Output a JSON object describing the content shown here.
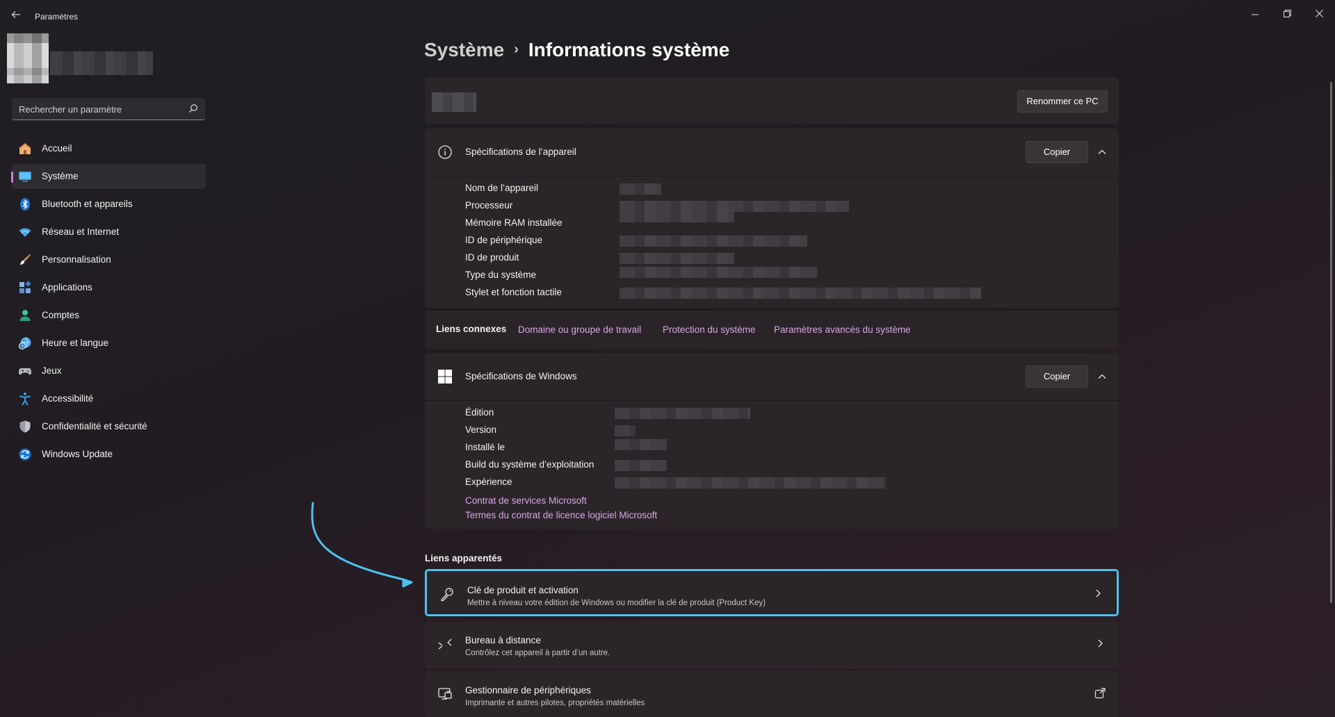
{
  "app": {
    "title": "Paramètres"
  },
  "search": {
    "placeholder": "Rechercher un paramètre"
  },
  "sidebar": {
    "items": [
      {
        "label": "Accueil",
        "icon": "home-icon"
      },
      {
        "label": "Système",
        "icon": "system-icon",
        "active": true
      },
      {
        "label": "Bluetooth et appareils",
        "icon": "bluetooth-icon"
      },
      {
        "label": "Réseau et Internet",
        "icon": "wifi-icon"
      },
      {
        "label": "Personnalisation",
        "icon": "brush-icon"
      },
      {
        "label": "Applications",
        "icon": "apps-icon"
      },
      {
        "label": "Comptes",
        "icon": "account-icon"
      },
      {
        "label": "Heure et langue",
        "icon": "globe-clock-icon"
      },
      {
        "label": "Jeux",
        "icon": "gamepad-icon"
      },
      {
        "label": "Accessibilité",
        "icon": "accessibility-icon"
      },
      {
        "label": "Confidentialité et sécurité",
        "icon": "shield-icon"
      },
      {
        "label": "Windows Update",
        "icon": "update-icon"
      }
    ]
  },
  "breadcrumb": {
    "parent": "Système",
    "separator": "›",
    "current": "Informations système"
  },
  "pc_card": {
    "rename_label": "Renommer ce PC"
  },
  "device_specs": {
    "title": "Spécifications de l’appareil",
    "copy_label": "Copier",
    "rows": [
      "Nom de l’appareil",
      "Processeur",
      "Mémoire RAM installée",
      "ID de périphérique",
      "ID de produit",
      "Type du système",
      "Stylet et fonction tactile"
    ]
  },
  "related_links": {
    "label": "Liens connexes",
    "links": [
      "Domaine ou groupe de travail",
      "Protection du système",
      "Paramètres avancés du système"
    ]
  },
  "windows_specs": {
    "title": "Spécifications de Windows",
    "copy_label": "Copier",
    "rows": [
      "Édition",
      "Version",
      "Installé le",
      "Build du système d’exploitation",
      "Expérience"
    ],
    "links": [
      "Contrat de services Microsoft",
      "Termes du contrat de licence logiciel Microsoft"
    ]
  },
  "related_section": {
    "title": "Liens apparentés",
    "items": [
      {
        "title": "Clé de produit et activation",
        "subtitle": "Mettre à niveau votre édition de Windows ou modifier la clé de produit (Product Key)",
        "icon": "key-icon",
        "action": "chevron-right-icon"
      },
      {
        "title": "Bureau à distance",
        "subtitle": "Contrôlez cet appareil à partir d’un autre.",
        "icon": "remote-desktop-icon",
        "action": "chevron-right-icon"
      },
      {
        "title": "Gestionnaire de périphériques",
        "subtitle": "Imprimante et autres pilotes, propriétés matérielles",
        "icon": "device-manager-icon",
        "action": "external-link-icon"
      }
    ]
  },
  "colors": {
    "accent": "#c983d8",
    "link": "#d9a6e6",
    "highlight": "#4cc2ee"
  }
}
